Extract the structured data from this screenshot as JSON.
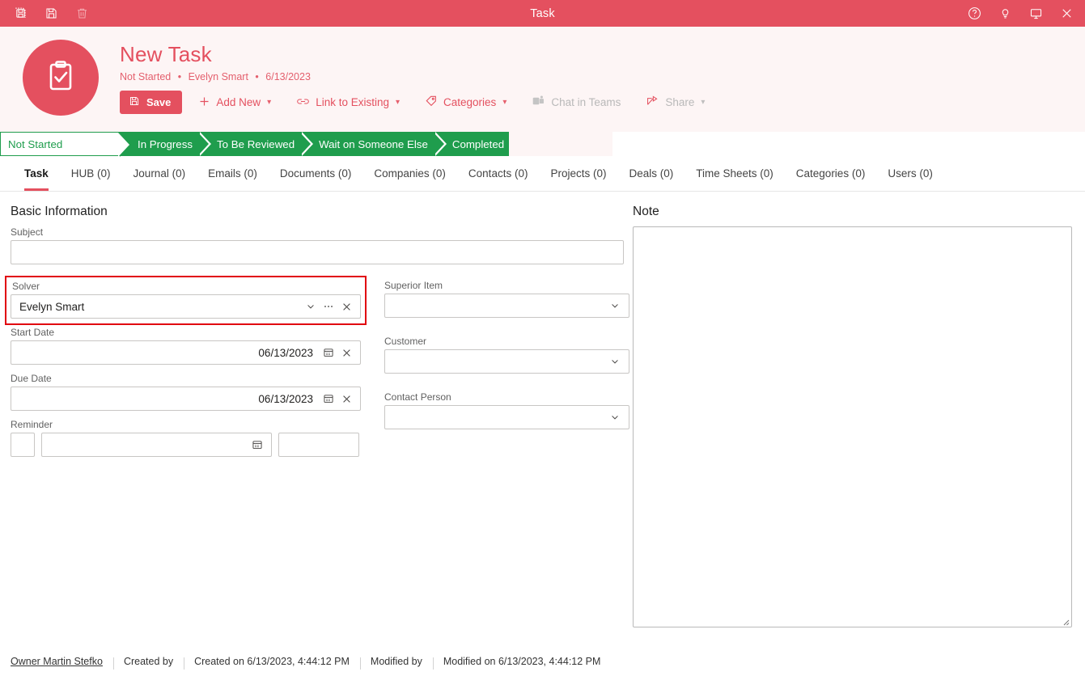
{
  "titlebar": {
    "title": "Task",
    "left_buttons": [
      {
        "name": "save-and-new-icon",
        "label": "Save & New"
      },
      {
        "name": "save-icon",
        "label": "Save"
      },
      {
        "name": "delete-icon",
        "label": "Delete"
      }
    ],
    "right_buttons": [
      {
        "name": "help-icon",
        "label": "Help"
      },
      {
        "name": "tips-icon",
        "label": "Tips"
      },
      {
        "name": "display-icon",
        "label": "Display"
      },
      {
        "name": "close-icon",
        "label": "Close"
      }
    ],
    "bg_color": "#e4505f"
  },
  "header": {
    "avatar_icon": "clipboard-check-icon",
    "title": "New Task",
    "subtitle_status": "Not Started",
    "subtitle_owner": "Evelyn Smart",
    "subtitle_date": "6/13/2023",
    "separator": "•",
    "accent_color": "#e4505f",
    "toolbar": {
      "save_label": "Save",
      "add_new_label": "Add New",
      "link_to_existing_label": "Link to Existing",
      "categories_label": "Categories",
      "chat_in_teams_label": "Chat in Teams",
      "share_label": "Share"
    }
  },
  "pipeline": {
    "color": "#1f9d4d",
    "stages": [
      {
        "label": "Not Started",
        "active": true
      },
      {
        "label": "In Progress",
        "active": false
      },
      {
        "label": "To Be Reviewed",
        "active": false
      },
      {
        "label": "Wait on Someone Else",
        "active": false
      },
      {
        "label": "Completed",
        "active": false
      }
    ]
  },
  "tabs": [
    {
      "label": "Task",
      "active": true
    },
    {
      "label": "HUB (0)",
      "active": false
    },
    {
      "label": "Journal (0)",
      "active": false
    },
    {
      "label": "Emails (0)",
      "active": false
    },
    {
      "label": "Documents (0)",
      "active": false
    },
    {
      "label": "Companies (0)",
      "active": false
    },
    {
      "label": "Contacts (0)",
      "active": false
    },
    {
      "label": "Projects (0)",
      "active": false
    },
    {
      "label": "Deals (0)",
      "active": false
    },
    {
      "label": "Time Sheets (0)",
      "active": false
    },
    {
      "label": "Categories (0)",
      "active": false
    },
    {
      "label": "Users (0)",
      "active": false
    }
  ],
  "form": {
    "section_title": "Basic Information",
    "subject": {
      "label": "Subject",
      "value": ""
    },
    "solver": {
      "label": "Solver",
      "value": "Evelyn Smart",
      "highlighted": true,
      "highlight_color": "#e1000f"
    },
    "start_date": {
      "label": "Start Date",
      "value": "06/13/2023"
    },
    "due_date": {
      "label": "Due Date",
      "value": "06/13/2023"
    },
    "reminder": {
      "label": "Reminder",
      "value": "",
      "extra_value": ""
    },
    "superior_item": {
      "label": "Superior Item",
      "value": ""
    },
    "customer": {
      "label": "Customer",
      "value": ""
    },
    "contact_person": {
      "label": "Contact Person",
      "value": ""
    }
  },
  "note": {
    "label": "Note",
    "value": ""
  },
  "footer": {
    "owner": "Owner Martin Stefko",
    "created_by": "Created by",
    "created_on": "Created on 6/13/2023, 4:44:12 PM",
    "modified_by": "Modified by",
    "modified_on": "Modified on 6/13/2023, 4:44:12 PM"
  }
}
